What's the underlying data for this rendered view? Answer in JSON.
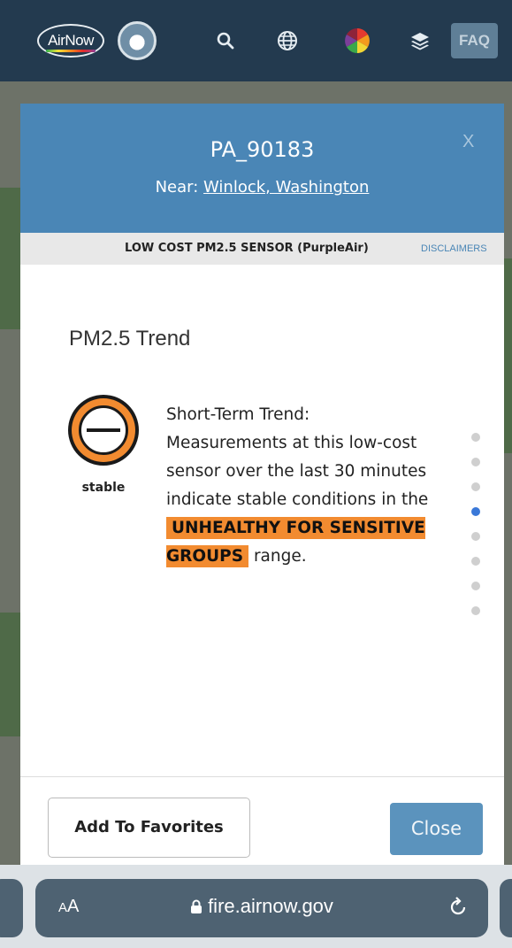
{
  "topbar": {
    "logo_text": "AirNow",
    "faq_label": "FAQ",
    "icons": [
      "search-icon",
      "globe-icon",
      "color-wheel-icon",
      "layers-icon"
    ]
  },
  "modal": {
    "site_id": "PA_90183",
    "near_prefix": "Near: ",
    "near_place": "Winlock, Washington",
    "close_x": "X",
    "sensor_type": "LOW COST PM2.5 SENSOR (PurpleAir)",
    "disclaimers": "DISCLAIMERS",
    "trend_title": "PM2.5 Trend",
    "trend_label": "stable",
    "trend_heading": "Short-Term Trend:",
    "trend_body": "Measurements at this low-cost sensor over the last 30 minutes indicate stable conditions in the",
    "category": "UNHEALTHY FOR SENSITIVE GROUPS",
    "trend_suffix": "range.",
    "pager": {
      "count": 8,
      "active_index": 3
    },
    "add_favorites_label": "Add To Favorites",
    "close_label": "Close"
  },
  "browser": {
    "text_size_label": "AA",
    "url": "fire.airnow.gov"
  },
  "colors": {
    "header_blue": "#4a86b6",
    "category_orange": "#f28b30",
    "active_dot": "#3a78d8"
  }
}
